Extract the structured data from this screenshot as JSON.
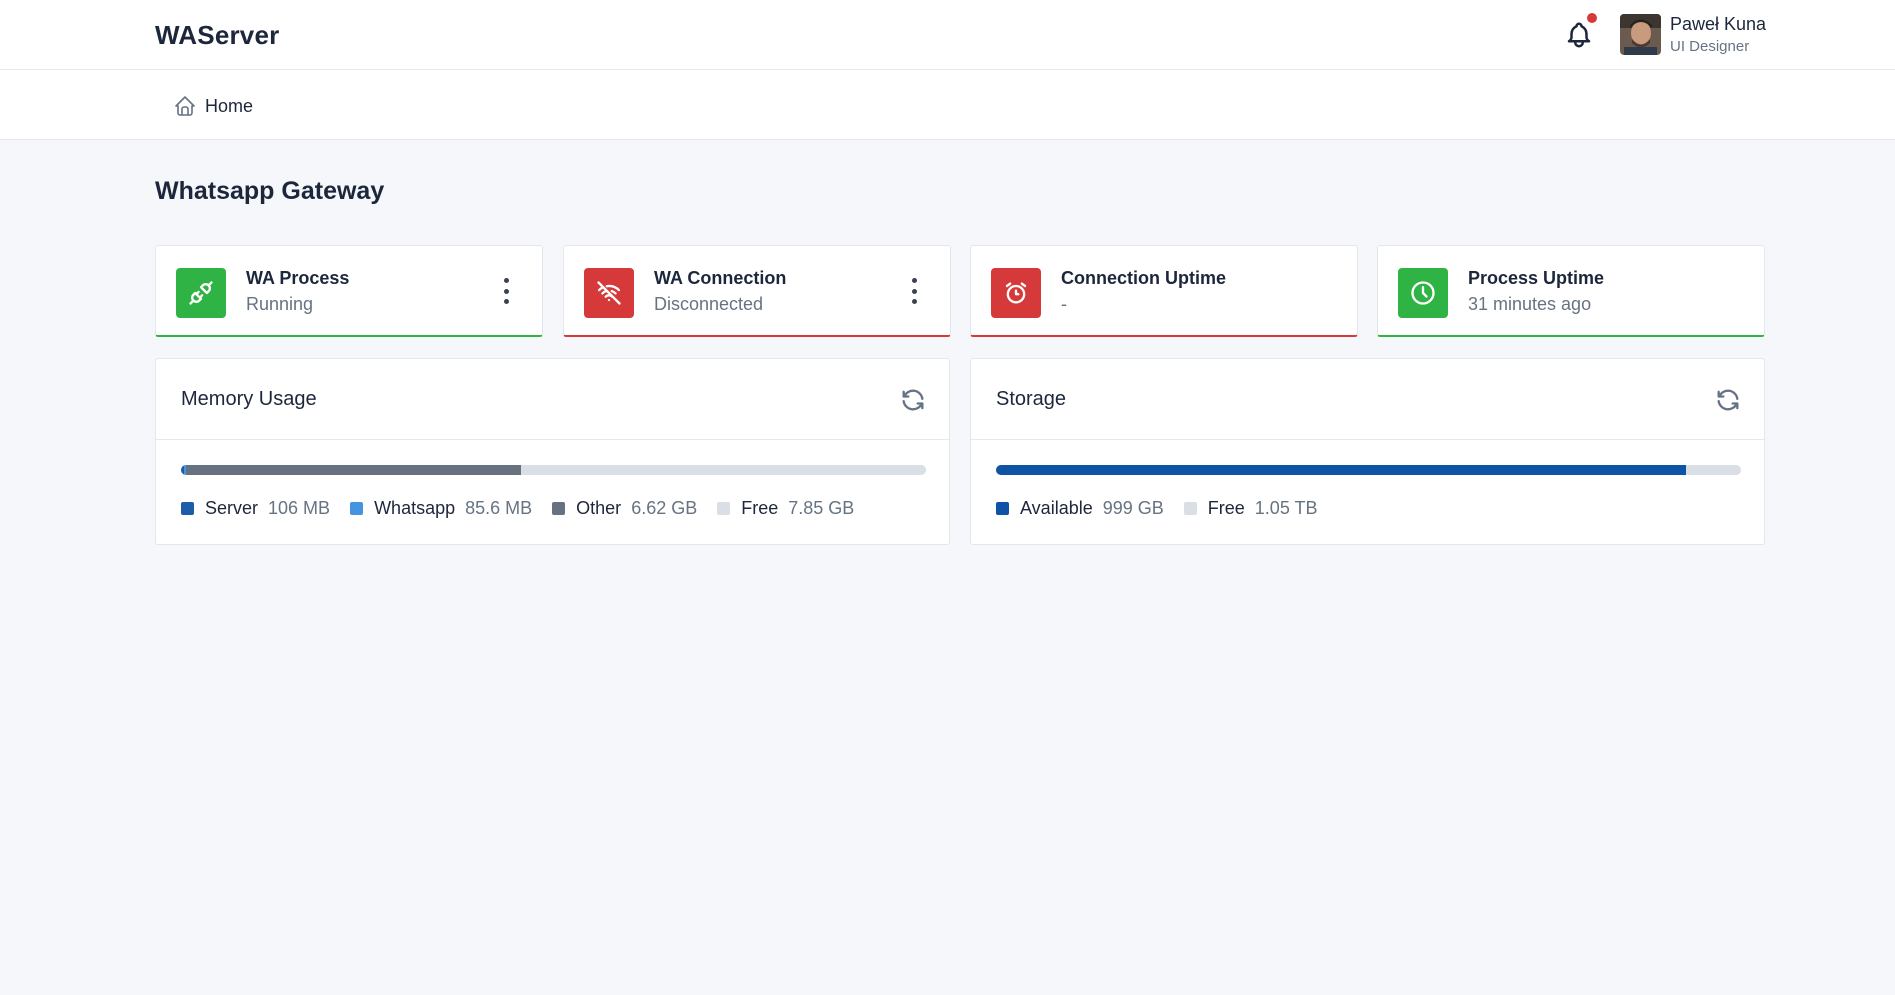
{
  "header": {
    "brand": "WAServer",
    "notification_icon": "bell-icon",
    "notification_dot_color": "#d63939",
    "user": {
      "name": "Paweł Kuna",
      "role": "UI Designer"
    }
  },
  "nav": {
    "home_label": "Home",
    "home_icon": "home-icon"
  },
  "page": {
    "title": "Whatsapp Gateway"
  },
  "stats": [
    {
      "title": "WA Process",
      "subtitle": "Running",
      "icon": "plug-icon",
      "status_color": "#2fb344"
    },
    {
      "title": "WA Connection",
      "subtitle": "Disconnected",
      "icon": "wifi-off-icon",
      "status_color": "#d63939"
    },
    {
      "title": "Connection Uptime",
      "subtitle": "-",
      "icon": "alarm-icon",
      "status_color": "#d63939"
    },
    {
      "title": "Process Uptime",
      "subtitle": "31 minutes ago",
      "icon": "clock-icon",
      "status_color": "#2fb344"
    }
  ],
  "memory": {
    "title": "Memory Usage",
    "segments": [
      {
        "label": "Server",
        "value": "106 MB",
        "fraction": 0.0036,
        "color": "#1c5ca8"
      },
      {
        "label": "Whatsapp",
        "value": "85.6 MB",
        "fraction": 0.0029,
        "color": "#4594e0"
      },
      {
        "label": "Other",
        "value": "6.62 GB",
        "fraction": 0.4502,
        "color": "#66727f"
      },
      {
        "label": "Free",
        "value": "7.85 GB",
        "fraction": 0.5433,
        "color": "#dadfe5"
      }
    ]
  },
  "storage": {
    "title": "Storage",
    "segments": [
      {
        "label": "Available",
        "value": "999 GB",
        "fraction": 0.926,
        "color": "#0f53a6"
      },
      {
        "label": "Free",
        "value": "1.05 TB",
        "fraction": 0.074,
        "color": "#dadfe5"
      }
    ]
  }
}
